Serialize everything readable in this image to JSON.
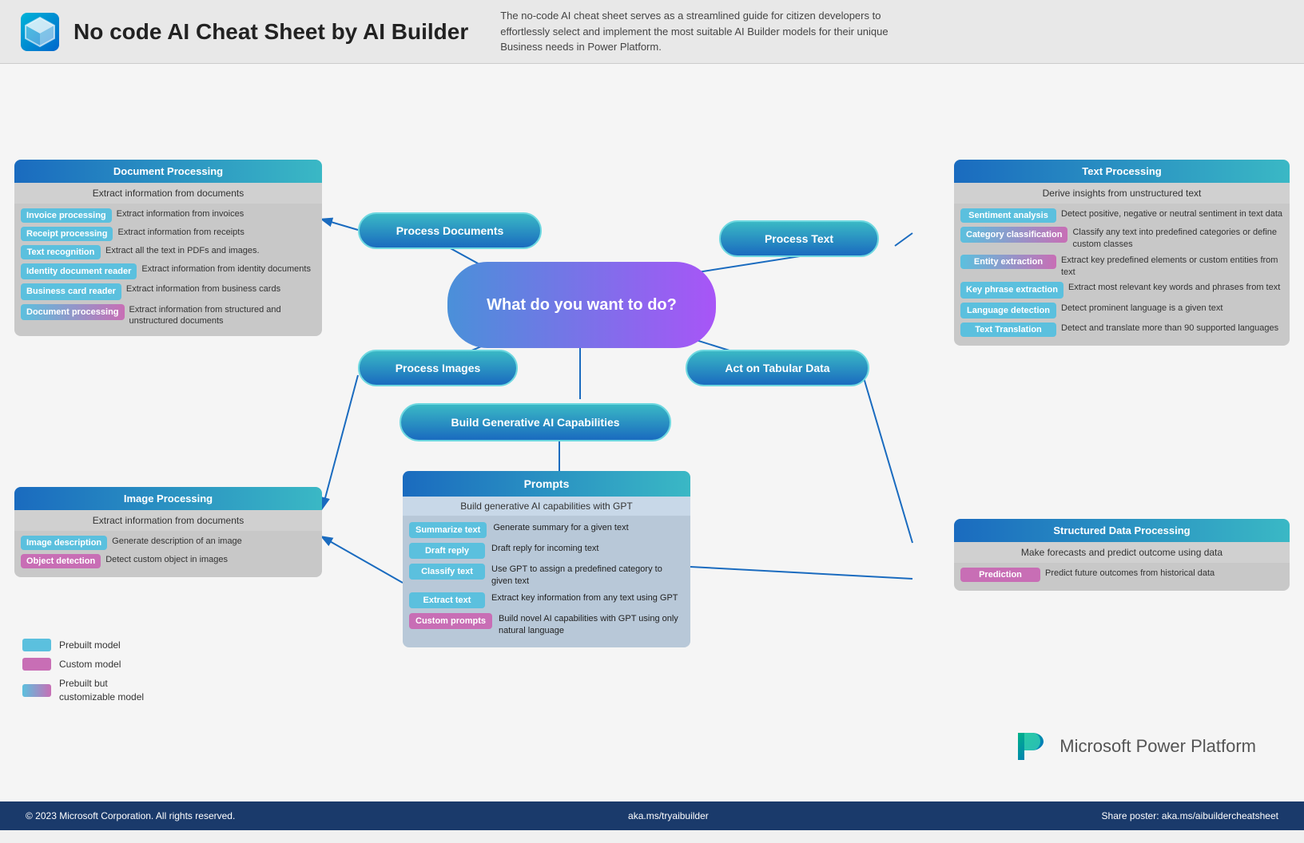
{
  "header": {
    "title": "No code AI Cheat Sheet by AI Builder",
    "description": "The no-code AI cheat sheet serves as a streamlined guide for citizen developers to effortlessly select and implement the most suitable AI Builder models for their unique Business needs in Power Platform."
  },
  "docProcessing": {
    "header": "Document Processing",
    "subtitle": "Extract information from documents",
    "rows": [
      {
        "tag": "Invoice processing",
        "text": "Extract information from invoices",
        "type": "blue"
      },
      {
        "tag": "Receipt processing",
        "text": "Extract information from receipts",
        "type": "blue"
      },
      {
        "tag": "Text  recognition",
        "text": "Extract all the text in PDFs and images.",
        "type": "blue"
      },
      {
        "tag": "Identity document reader",
        "text": "Extract information from identity documents",
        "type": "blue"
      },
      {
        "tag": "Business card reader",
        "text": "Extract information from business cards",
        "type": "blue"
      },
      {
        "tag": "Document processing",
        "text": "Extract information from structured and unstructured documents",
        "type": "gradient"
      }
    ]
  },
  "imageProcessing": {
    "header": "Image Processing",
    "subtitle": "Extract information from documents",
    "rows": [
      {
        "tag": "Image description",
        "text": "Generate description of an image",
        "type": "blue"
      },
      {
        "tag": "Object detection",
        "text": "Detect custom object in images",
        "type": "pink"
      }
    ]
  },
  "textProcessing": {
    "header": "Text Processing",
    "subtitle": "Derive insights from unstructured text",
    "rows": [
      {
        "tag": "Sentiment analysis",
        "text": "Detect positive, negative or neutral sentiment in text data",
        "type": "blue"
      },
      {
        "tag": "Category classification",
        "text": "Classify any text into predefined categories or define custom classes",
        "type": "gradient"
      },
      {
        "tag": "Entity extraction",
        "text": "Extract key predefined elements or custom entities from text",
        "type": "gradient"
      },
      {
        "tag": "Key phrase extraction",
        "text": "Extract most relevant key words and phrases from text",
        "type": "blue"
      },
      {
        "tag": "Language detection",
        "text": "Detect prominent language is a given text",
        "type": "blue"
      },
      {
        "tag": "Text Translation",
        "text": "Detect and translate more than 90 supported languages",
        "type": "blue"
      }
    ]
  },
  "structuredData": {
    "header": "Structured Data Processing",
    "subtitle": "Make forecasts and predict outcome using data",
    "rows": [
      {
        "tag": "Prediction",
        "text": "Predict future outcomes from historical data",
        "type": "pink"
      }
    ]
  },
  "prompts": {
    "header": "Prompts",
    "subtitle": "Build generative AI capabilities with GPT",
    "rows": [
      {
        "tag": "Summarize text",
        "text": "Generate summary for a given text",
        "type": "blue"
      },
      {
        "tag": "Draft reply",
        "text": "Draft reply for incoming text",
        "type": "blue"
      },
      {
        "tag": "Classify text",
        "text": "Use GPT to assign a predefined category to given text",
        "type": "blue"
      },
      {
        "tag": "Extract text",
        "text": "Extract key information from any text using GPT",
        "type": "blue"
      },
      {
        "tag": "Custom prompts",
        "text": "Build novel AI capabilities with GPT using only natural language",
        "type": "pink"
      }
    ]
  },
  "ovals": {
    "processDocuments": "Process Documents",
    "processText": "Process Text",
    "processImages": "Process Images",
    "actTabular": "Act on Tabular Data",
    "buildGenerative": "Build Generative AI Capabilities",
    "main": "What do you want to do?"
  },
  "legend": {
    "items": [
      {
        "label": "Prebuilt model",
        "type": "blue"
      },
      {
        "label": "Custom model",
        "type": "pink"
      },
      {
        "label": "Prebuilt but customizable model",
        "type": "gradient"
      }
    ]
  },
  "footer": {
    "copyright": "© 2023 Microsoft Corporation. All rights reserved.",
    "url": "aka.ms/tryaibuilder",
    "share": "Share poster: aka.ms/aibuildercheatsheet"
  }
}
